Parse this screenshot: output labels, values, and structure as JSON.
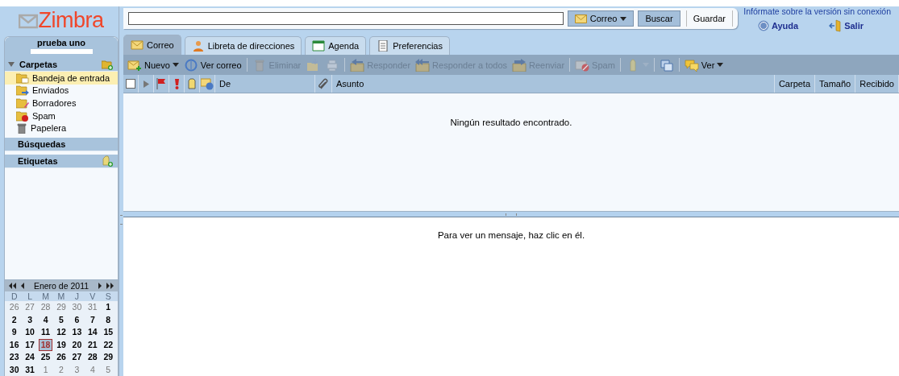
{
  "logo": {
    "text": "Zimbra"
  },
  "search": {
    "button_type": "Correo",
    "search_button": "Buscar",
    "save_button": "Guardar"
  },
  "top_links": {
    "offline_link": "Infórmate sobre la versión sin conexión",
    "help": "Ayuda",
    "logout": "Salir"
  },
  "tabs": [
    {
      "label": "Correo",
      "selected": true
    },
    {
      "label": "Libreta de direcciones",
      "selected": false
    },
    {
      "label": "Agenda",
      "selected": false
    },
    {
      "label": "Preferencias",
      "selected": false
    }
  ],
  "toolbar": [
    {
      "kind": "button",
      "label": "Nuevo",
      "dropdown": true,
      "disabled": false
    },
    {
      "kind": "button",
      "label": "Ver correo",
      "dropdown": false,
      "disabled": false
    },
    {
      "kind": "separator"
    },
    {
      "kind": "button",
      "label": "Eliminar",
      "dropdown": false,
      "disabled": true
    },
    {
      "kind": "button",
      "dropdown": false,
      "disabled": true
    },
    {
      "kind": "button",
      "dropdown": false,
      "disabled": true
    },
    {
      "kind": "separator"
    },
    {
      "kind": "button",
      "label": "Responder",
      "dropdown": false,
      "disabled": true
    },
    {
      "kind": "button",
      "label": "Responder a todos",
      "dropdown": false,
      "disabled": true
    },
    {
      "kind": "button",
      "label": "Reenviar",
      "dropdown": false,
      "disabled": true
    },
    {
      "kind": "separator"
    },
    {
      "kind": "button",
      "label": "Spam",
      "dropdown": false,
      "disabled": true
    },
    {
      "kind": "separator"
    },
    {
      "kind": "button",
      "dropdown": true,
      "disabled": true
    },
    {
      "kind": "separator"
    },
    {
      "kind": "button",
      "dropdown": false,
      "disabled": false
    },
    {
      "kind": "separator"
    },
    {
      "kind": "button",
      "label": "Ver",
      "dropdown": true,
      "disabled": false
    }
  ],
  "columns": [
    {
      "kind": "checkbox",
      "checked": false
    },
    {
      "kind": "expand"
    },
    {
      "kind": "flag"
    },
    {
      "kind": "priority"
    },
    {
      "kind": "tag"
    },
    {
      "kind": "status"
    },
    {
      "kind": "text",
      "label": "De",
      "grow": false
    },
    {
      "kind": "attachment"
    },
    {
      "kind": "text",
      "label": "Asunto",
      "grow": true
    },
    {
      "kind": "text",
      "label": "Carpeta",
      "grow": false
    },
    {
      "kind": "text",
      "label": "Tamaño",
      "grow": false
    },
    {
      "kind": "text",
      "label": "Recibido",
      "grow": false
    }
  ],
  "list_message": "Ningún resultado encontrado.",
  "reading_message": "Para ver un mensaje, haz clic en él.",
  "account": {
    "name": "prueba uno"
  },
  "folders_header": "Carpetas",
  "folders": [
    {
      "label": "Bandeja de entrada",
      "selected": true
    },
    {
      "label": "Enviados",
      "selected": false
    },
    {
      "label": "Borradores",
      "selected": false
    },
    {
      "label": "Spam",
      "selected": false
    },
    {
      "label": "Papelera",
      "selected": false
    }
  ],
  "searches_header": "Búsquedas",
  "tags_header": "Etiquetas",
  "calendar": {
    "title": "Enero de 2011",
    "weekdays": [
      "D",
      "L",
      "M",
      "M",
      "J",
      "V",
      "S"
    ],
    "weeks": [
      [
        {
          "day": "26",
          "other_month": true,
          "selected": false
        },
        {
          "day": "27",
          "other_month": true,
          "selected": false
        },
        {
          "day": "28",
          "other_month": true,
          "selected": false
        },
        {
          "day": "29",
          "other_month": true,
          "selected": false
        },
        {
          "day": "30",
          "other_month": true,
          "selected": false
        },
        {
          "day": "31",
          "other_month": true,
          "selected": false
        },
        {
          "day": "1",
          "other_month": false,
          "selected": false
        }
      ],
      [
        {
          "day": "2",
          "other_month": false,
          "selected": false
        },
        {
          "day": "3",
          "other_month": false,
          "selected": false
        },
        {
          "day": "4",
          "other_month": false,
          "selected": false
        },
        {
          "day": "5",
          "other_month": false,
          "selected": false
        },
        {
          "day": "6",
          "other_month": false,
          "selected": false
        },
        {
          "day": "7",
          "other_month": false,
          "selected": false
        },
        {
          "day": "8",
          "other_month": false,
          "selected": false
        }
      ],
      [
        {
          "day": "9",
          "other_month": false,
          "selected": false
        },
        {
          "day": "10",
          "other_month": false,
          "selected": false
        },
        {
          "day": "11",
          "other_month": false,
          "selected": false
        },
        {
          "day": "12",
          "other_month": false,
          "selected": false
        },
        {
          "day": "13",
          "other_month": false,
          "selected": false
        },
        {
          "day": "14",
          "other_month": false,
          "selected": false
        },
        {
          "day": "15",
          "other_month": false,
          "selected": false
        }
      ],
      [
        {
          "day": "16",
          "other_month": false,
          "selected": false
        },
        {
          "day": "17",
          "other_month": false,
          "selected": false
        },
        {
          "day": "18",
          "other_month": false,
          "selected": true
        },
        {
          "day": "19",
          "other_month": false,
          "selected": false
        },
        {
          "day": "20",
          "other_month": false,
          "selected": false
        },
        {
          "day": "21",
          "other_month": false,
          "selected": false
        },
        {
          "day": "22",
          "other_month": false,
          "selected": false
        }
      ],
      [
        {
          "day": "23",
          "other_month": false,
          "selected": false
        },
        {
          "day": "24",
          "other_month": false,
          "selected": false
        },
        {
          "day": "25",
          "other_month": false,
          "selected": false
        },
        {
          "day": "26",
          "other_month": false,
          "selected": false
        },
        {
          "day": "27",
          "other_month": false,
          "selected": false
        },
        {
          "day": "28",
          "other_month": false,
          "selected": false
        },
        {
          "day": "29",
          "other_month": false,
          "selected": false
        }
      ],
      [
        {
          "day": "30",
          "other_month": false,
          "selected": false
        },
        {
          "day": "31",
          "other_month": false,
          "selected": false
        },
        {
          "day": "1",
          "other_month": true,
          "selected": false
        },
        {
          "day": "2",
          "other_month": true,
          "selected": false
        },
        {
          "day": "3",
          "other_month": true,
          "selected": false
        },
        {
          "day": "4",
          "other_month": true,
          "selected": false
        },
        {
          "day": "5",
          "other_month": true,
          "selected": false
        }
      ]
    ]
  }
}
